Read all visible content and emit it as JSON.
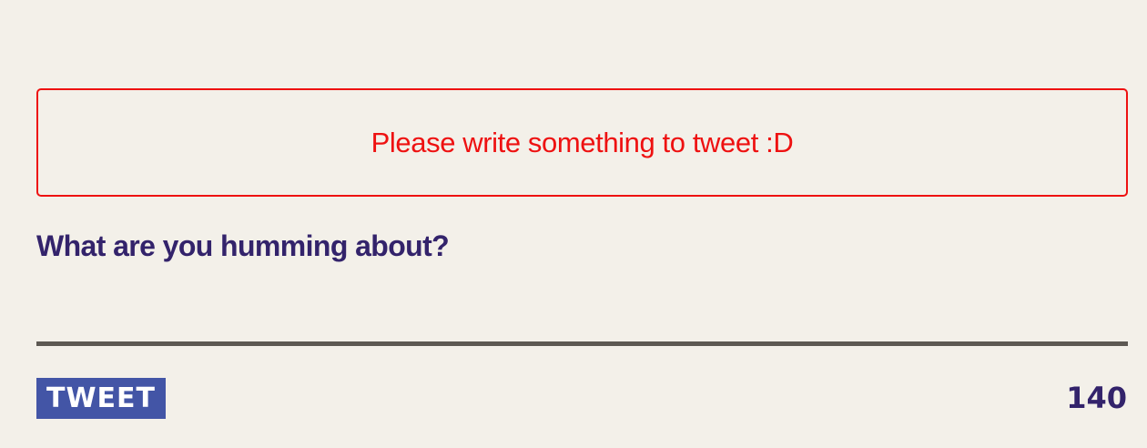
{
  "error": {
    "message": "Please write something to tweet :D"
  },
  "composer": {
    "prompt": "What are you humming about?",
    "input_value": "",
    "input_placeholder": ""
  },
  "actions": {
    "tweet_label": "TWEET",
    "char_count": "140"
  },
  "colors": {
    "background": "#f3f0e9",
    "error": "#ee1111",
    "text_primary": "#33236b",
    "button_bg": "#4355a6",
    "divider": "#5d5953"
  }
}
